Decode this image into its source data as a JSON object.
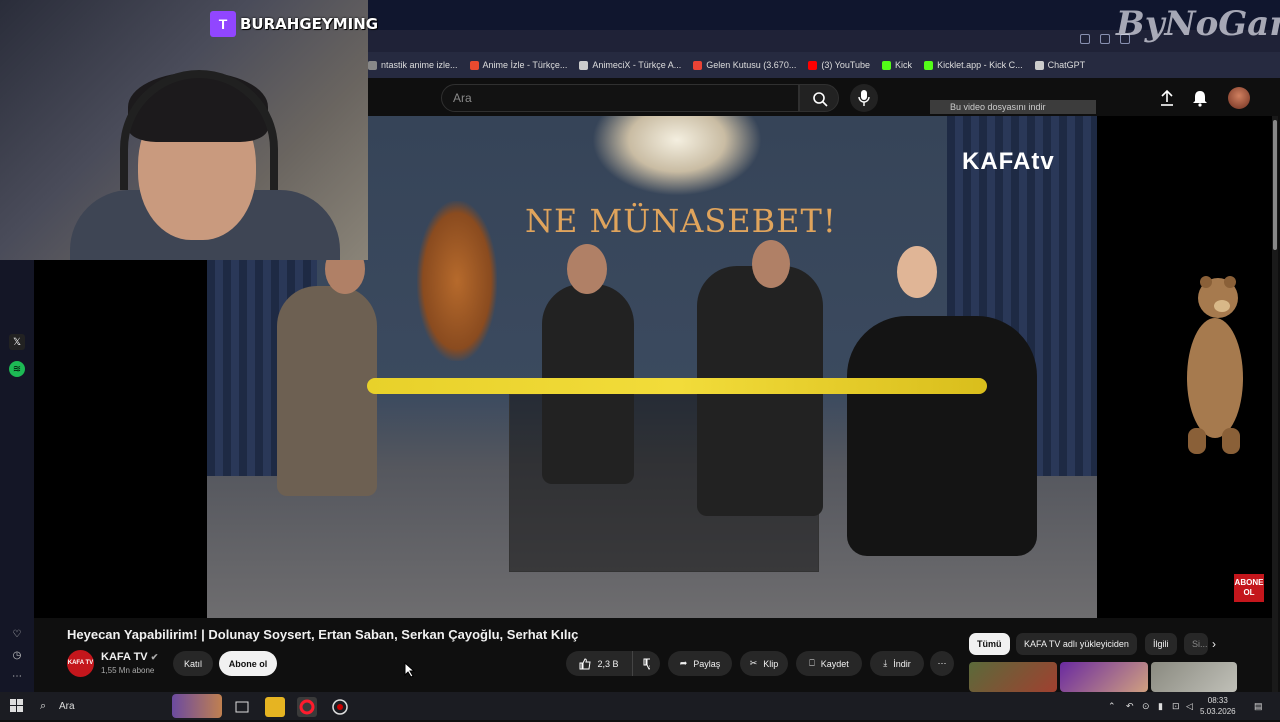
{
  "browser": {
    "bookmarks": [
      {
        "label": "ntastik anime izle...",
        "color": "#888888"
      },
      {
        "label": "Anime İzle - Türkçe...",
        "color": "#e84a2f"
      },
      {
        "label": "AnimeciX - Türkçe A...",
        "color": "#cccccc"
      },
      {
        "label": "Gelen Kutusu (3.670...",
        "color": "#ea4335"
      },
      {
        "label": "(3) YouTube",
        "color": "#ff0000"
      },
      {
        "label": "Kick",
        "color": "#53fc18"
      },
      {
        "label": "Kicklet.app - Kick C...",
        "color": "#53fc18"
      },
      {
        "label": "ChatGPT",
        "color": "#cccccc"
      }
    ]
  },
  "overlay": {
    "twitch_logo": "T",
    "twitch_name": "BURAHGEYMING",
    "watermark": "ByNoGame"
  },
  "youtube": {
    "search_placeholder": "Ara",
    "icons": {
      "search": "search-icon",
      "mic": "mic-icon",
      "upload": "upload-icon",
      "bell": "bell-icon"
    }
  },
  "video": {
    "stage_sign": "NE MÜNASEBET!",
    "channel_logo": "KAFAtv",
    "download_hint": "Bu video dosyasını indir",
    "abone_badge": "ABONE OL",
    "title": "Heyecan Yapabilirim! | Dolunay Soysert, Ertan Saban, Serkan Çayoğlu, Serhat Kılıç"
  },
  "channel": {
    "avatar_text": "KAFA TV",
    "name": "KAFA TV",
    "subscribers": "1,55 Mn abone",
    "join_label": "Katıl",
    "subscribe_label": "Abone ol"
  },
  "actions": {
    "likes": "2,3 B",
    "share": "Paylaş",
    "clip": "Klip",
    "save": "Kaydet",
    "download": "İndir"
  },
  "chips": [
    "Tümü",
    "KAFA TV adlı yükleyiciden",
    "İlgili",
    "Si..."
  ],
  "taskbar": {
    "search_label": "Ara",
    "time": "08:33",
    "date": "5.03.2026"
  }
}
